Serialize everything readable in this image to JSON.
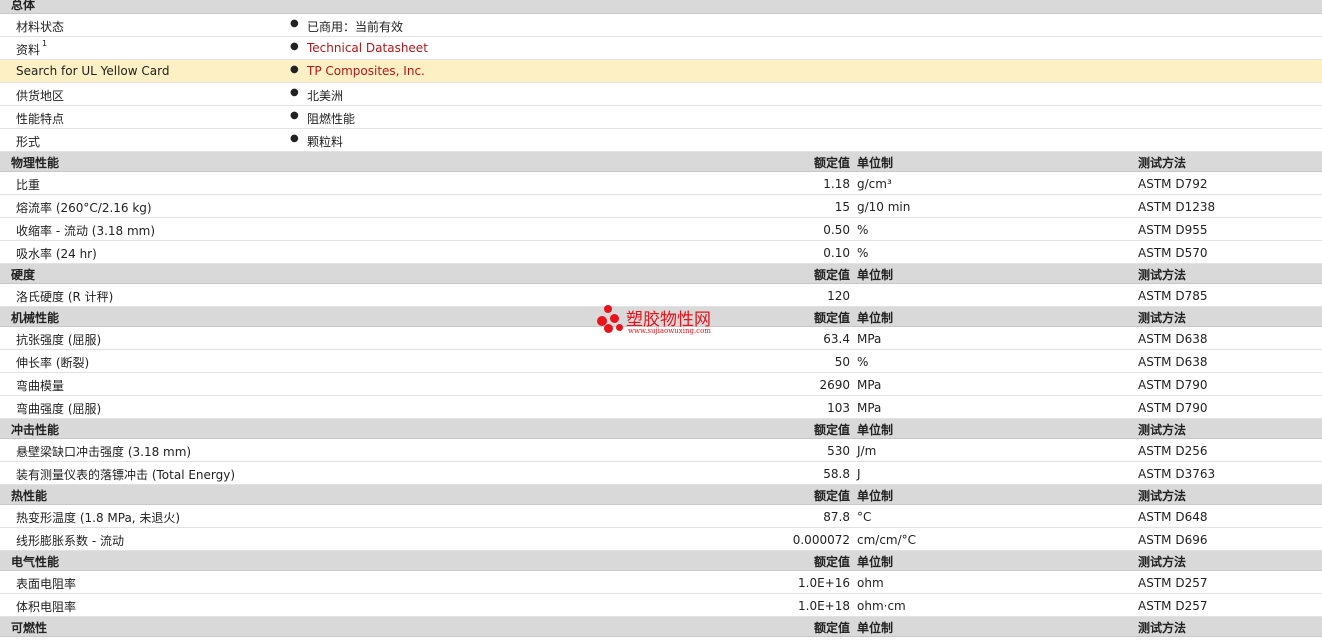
{
  "general": {
    "title": "总体",
    "rows": [
      {
        "label": "材料状态",
        "value": "已商用：当前有效"
      },
      {
        "label": "资料",
        "sup": "1",
        "value": "Technical Datasheet"
      },
      {
        "label": "Search for UL Yellow Card",
        "value": "TP Composites, Inc."
      },
      {
        "label": "供货地区",
        "value": "北美洲"
      },
      {
        "label": "性能特点",
        "value": "阻燃性能"
      },
      {
        "label": "形式",
        "value": "颗粒料"
      }
    ]
  },
  "columns": {
    "value": "额定值",
    "unit": "单位制",
    "method": "测试方法"
  },
  "physical": {
    "title": "物理性能",
    "rows": [
      {
        "label": "比重",
        "value": "1.18",
        "unit": "g/cm³",
        "method": "ASTM D792"
      },
      {
        "label": "熔流率  (260°C/2.16 kg)",
        "value": "15",
        "unit": "g/10 min",
        "method": "ASTM D1238"
      },
      {
        "label": "收缩率  - 流动  (3.18 mm)",
        "value": "0.50",
        "unit": "%",
        "method": "ASTM D955"
      },
      {
        "label": "吸水率  (24 hr)",
        "value": "0.10",
        "unit": "%",
        "method": "ASTM D570"
      }
    ]
  },
  "hardness": {
    "title": "硬度",
    "rows": [
      {
        "label": "洛氏硬度  (R 计秤)",
        "value": "120",
        "unit": "",
        "method": "ASTM D785"
      }
    ]
  },
  "mechanical": {
    "title": "机械性能",
    "rows": [
      {
        "label": "抗张强度  (屈服)",
        "value": "63.4",
        "unit": "MPa",
        "method": "ASTM D638"
      },
      {
        "label": "伸长率  (断裂)",
        "value": "50",
        "unit": "%",
        "method": "ASTM D638"
      },
      {
        "label": "弯曲模量",
        "value": "2690",
        "unit": "MPa",
        "method": "ASTM D790"
      },
      {
        "label": "弯曲强度  (屈服)",
        "value": "103",
        "unit": "MPa",
        "method": "ASTM D790"
      }
    ]
  },
  "impact": {
    "title": "冲击性能",
    "rows": [
      {
        "label": "悬壁梁缺口冲击强度  (3.18 mm)",
        "value": "530",
        "unit": "J/m",
        "method": "ASTM D256"
      },
      {
        "label": "装有测量仪表的落镖冲击  (Total Energy)",
        "value": "58.8",
        "unit": "J",
        "method": "ASTM D3763"
      }
    ]
  },
  "thermal": {
    "title": "热性能",
    "rows": [
      {
        "label": "热变形温度  (1.8 MPa, 未退火)",
        "value": "87.8",
        "unit": "°C",
        "method": "ASTM D648"
      },
      {
        "label": "线形膨胀系数  - 流动",
        "value": "0.000072",
        "unit": "cm/cm/°C",
        "method": "ASTM D696"
      }
    ]
  },
  "electrical": {
    "title": "电气性能",
    "rows": [
      {
        "label": "表面电阻率",
        "value": "1.0E+16",
        "unit": "ohm",
        "method": "ASTM D257"
      },
      {
        "label": "体积电阻率",
        "value": "1.0E+18",
        "unit": "ohm·cm",
        "method": "ASTM D257"
      }
    ]
  },
  "flammability": {
    "title": "可燃性"
  },
  "watermark": {
    "name": "塑胶物性网",
    "url": "www.sujiaowuxing.com"
  }
}
